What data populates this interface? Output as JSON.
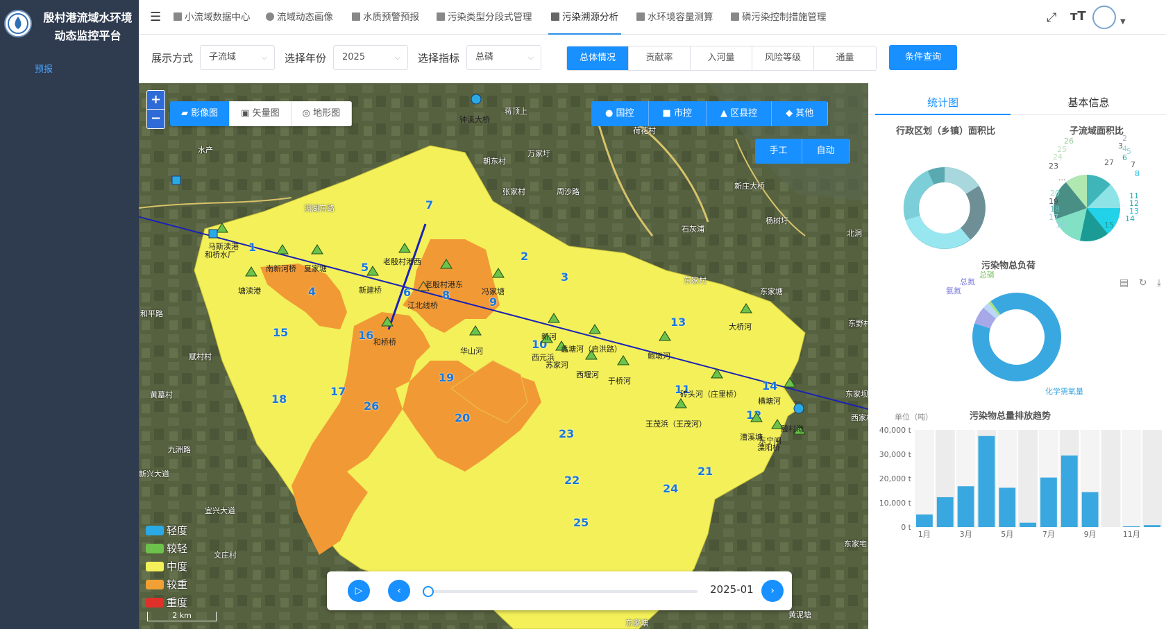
{
  "app": {
    "title_line1": "殷村港流域水环境",
    "title_line2": "动态监控平台",
    "sidebar_item": "预报"
  },
  "nav": {
    "tabs": [
      "小流域数据中心",
      "流域动态画像",
      "水质预警预报",
      "污染类型分段式管理",
      "污染溯源分析",
      "水环境容量测算",
      "磷污染控制措施管理"
    ],
    "active": "污染溯源分析"
  },
  "filters": {
    "display_label": "展示方式",
    "display_value": "子流域",
    "year_label": "选择年份",
    "year_value": "2025",
    "indicator_label": "选择指标",
    "indicator_value": "总磷",
    "view_tabs": [
      "总体情况",
      "贡献率",
      "入河量",
      "风险等级",
      "通量"
    ],
    "active_view": "总体情况",
    "query_button": "条件查询"
  },
  "map": {
    "basemaps": [
      "影像图",
      "矢量图",
      "地形图"
    ],
    "active_basemap": "影像图",
    "station_types": [
      "国控",
      "市控",
      "区县控",
      "其他"
    ],
    "modes": [
      "手工",
      "自动"
    ],
    "legend": [
      {
        "label": "轻度",
        "color": "#29a9e6"
      },
      {
        "label": "较轻",
        "color": "#6cc24a"
      },
      {
        "label": "中度",
        "color": "#f3f05a"
      },
      {
        "label": "较重",
        "color": "#f0a035"
      },
      {
        "label": "重度",
        "color": "#e0302a"
      }
    ],
    "scale": "2 km",
    "timeline_date": "2025-01",
    "subbasin_numbers": [
      "1",
      "2",
      "3",
      "4",
      "5",
      "6",
      "7",
      "8",
      "9",
      "10",
      "11",
      "12",
      "13",
      "14",
      "15",
      "16",
      "17",
      "18",
      "19",
      "20",
      "21",
      "22",
      "23",
      "24",
      "25",
      "26"
    ],
    "station_labels": [
      "钟溪大桥",
      "马斯渎港",
      "和桥水厂",
      "南新河桥",
      "夏家塘",
      "老殷村港西",
      "老殷村港东",
      "塘渎港",
      "新建桥",
      "江北线桥",
      "冯家塘",
      "和桥桥",
      "华山河",
      "新河",
      "西元浜",
      "蠡塘河（启洪路）",
      "苏家河",
      "西堰河",
      "于桥河",
      "鲍墩河",
      "大桥河",
      "砖头河（庄里桥）",
      "王茂浜（王茂河）",
      "漕溪塘",
      "殷村港",
      "溧阳桥",
      "东宁闸",
      "横塘河"
    ],
    "place_labels": [
      "水产",
      "蒋顶上",
      "荷花村",
      "万家圩",
      "朝东村",
      "张家村",
      "周沙路",
      "新庄大桥",
      "杨树圩",
      "石灰浦",
      "东家村",
      "东家塘",
      "北洞",
      "东野村",
      "黄泥塘",
      "东家塘",
      "宜兴大道",
      "滆湖东路",
      "文庄村",
      "东家坝",
      "东家宅",
      "西家村",
      "黄墓村",
      "赋村村",
      "九洲路",
      "新兴大道",
      "和平路"
    ]
  },
  "panel": {
    "tabs": [
      "统计图",
      "基本信息"
    ],
    "active_tab": "统计图",
    "chart1_title": "行政区划（乡镇）面积比",
    "chart2_title": "子流域面积比",
    "chart2_labels": [
      "1",
      "2",
      "3",
      "4",
      "5",
      "6",
      "7",
      "8",
      "11",
      "12",
      "13",
      "14",
      "15",
      "16",
      "17",
      "18",
      "19",
      "20",
      "23",
      "24",
      "25",
      "26",
      "27",
      "..."
    ],
    "chart3_title": "污染物总负荷",
    "chart3_labels": [
      "总磷",
      "总氮",
      "氨氮",
      "化学需氧量"
    ],
    "chart4_title": "污染物总量排放趋势",
    "chart4_unit": "单位（吨）"
  },
  "chart_data": [
    {
      "type": "pie",
      "title": "污染物总负荷",
      "labels": [
        "化学需氧量",
        "氨氮",
        "总氮",
        "总磷"
      ],
      "values": [
        90,
        6.5,
        2.5,
        1
      ],
      "colors": [
        "#3aa8e0",
        "#a7a8e8",
        "#b9d8f7",
        "#a7e27f"
      ]
    },
    {
      "type": "bar",
      "title": "污染物总量排放趋势",
      "ylabel": "单位（吨）",
      "categories": [
        "1月",
        "2月",
        "3月",
        "4月",
        "5月",
        "6月",
        "7月",
        "8月",
        "9月",
        "10月",
        "11月",
        "12月"
      ],
      "values": [
        5200,
        12300,
        16800,
        37500,
        16200,
        1800,
        20400,
        29500,
        14400,
        0,
        300,
        800
      ],
      "ylim": [
        0,
        40000
      ],
      "yticks": [
        "0 t",
        "10,000 t",
        "20,000 t",
        "30,000 t",
        "40,000 t"
      ],
      "xticks_shown": [
        "1月",
        "3月",
        "5月",
        "7月",
        "9月",
        "11月"
      ]
    }
  ]
}
